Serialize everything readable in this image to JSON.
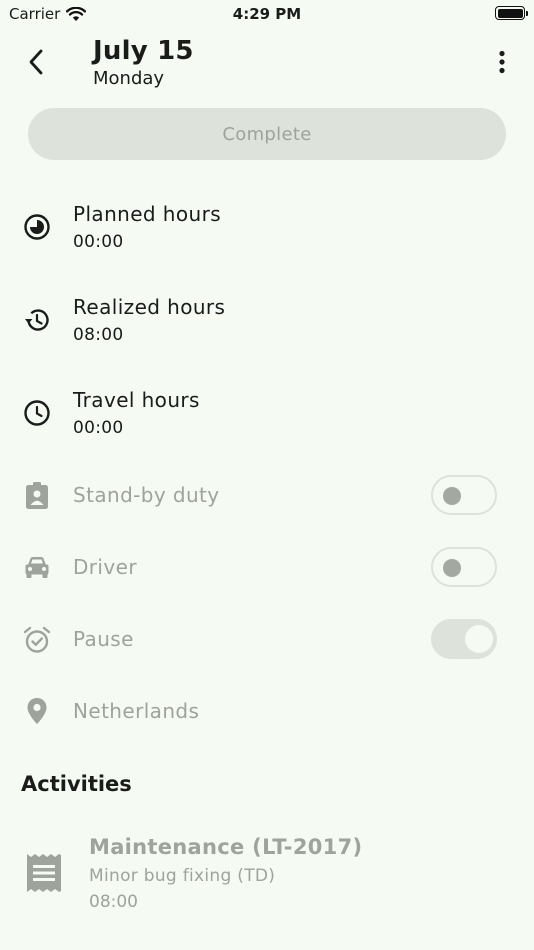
{
  "status_bar": {
    "carrier": "Carrier",
    "time": "4:29 PM"
  },
  "header": {
    "title": "July 15",
    "subtitle": "Monday"
  },
  "complete_button": {
    "label": "Complete"
  },
  "hours": [
    {
      "label": "Planned hours",
      "value": "00:00",
      "icon": "pie-clock-icon"
    },
    {
      "label": "Realized hours",
      "value": "08:00",
      "icon": "history-icon"
    },
    {
      "label": "Travel hours",
      "value": "00:00",
      "icon": "clock-icon"
    }
  ],
  "toggles": [
    {
      "label": "Stand-by duty",
      "icon": "badge-icon",
      "on": false
    },
    {
      "label": "Driver",
      "icon": "car-icon",
      "on": false
    },
    {
      "label": "Pause",
      "icon": "alarm-icon",
      "on": true
    }
  ],
  "location": {
    "label": "Netherlands",
    "icon": "location-pin-icon"
  },
  "activities": {
    "title": "Activities",
    "items": [
      {
        "title": "Maintenance (LT-2017)",
        "subtitle": "Minor bug fixing (TD)",
        "time": "08:00",
        "icon": "receipt-icon"
      }
    ]
  },
  "colors": {
    "background": "#f5faf3",
    "disabled_text": "#9ea39b",
    "button_bg": "#dde2da",
    "text": "#1a1c19"
  }
}
